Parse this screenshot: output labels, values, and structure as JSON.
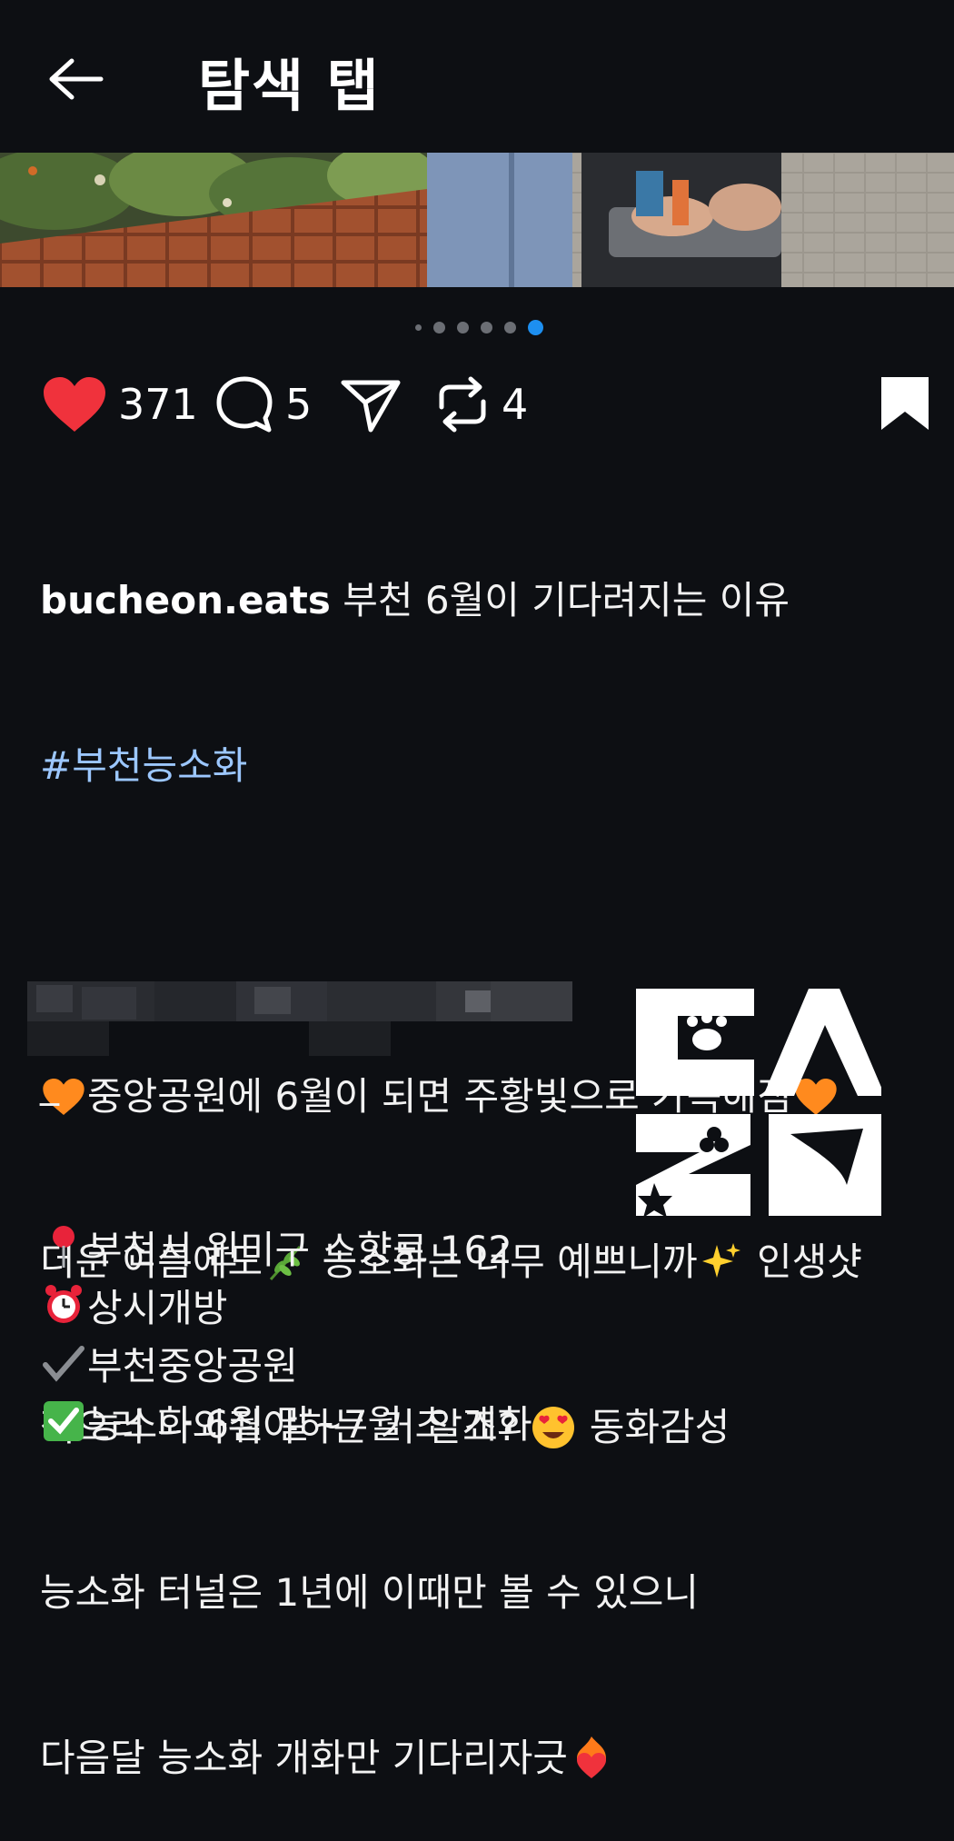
{
  "header": {
    "title": "탐색 탭",
    "back_icon": "arrow-left-icon"
  },
  "carousel": {
    "count": 6,
    "active_index": 5
  },
  "actions": {
    "likes": "371",
    "comments": "5",
    "reposts": "4",
    "like_color": "#f0323c"
  },
  "post": {
    "username": "bucheon.eats",
    "caption_title": " 부천 6월이 기다려지는 이유",
    "hashtag": "#부천능소화",
    "lines": [
      "중앙공원에 6월이 되면 주황빛으로 가득해짐",
      "더운 여름에도",
      " 능소화는 너무 예쁘니까",
      " 인생샷",
      "찍으러 나와줘야하는 거 알죠? ",
      " 동화감성",
      "능소화 터널은 1년에 이때만 볼 수 있으니",
      "다음달 능소화 개화만 기다리자긋"
    ],
    "dash": "_",
    "info": [
      "부천시 원미구 소향로 162",
      "상시개방",
      "부천중앙공원",
      "능소화 6월 말~7월 초 개화"
    ]
  },
  "logo": {
    "letters": "EAZO"
  }
}
